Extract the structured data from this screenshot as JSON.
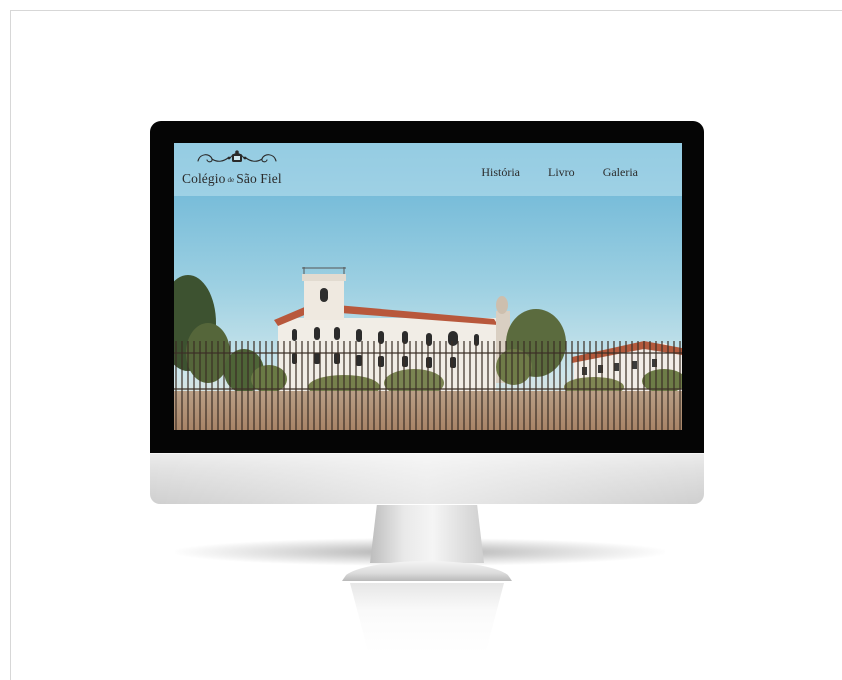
{
  "site": {
    "logo": {
      "word1": "Colégio",
      "word2": "de",
      "word3": "São Fiel"
    },
    "nav": [
      {
        "label": "História"
      },
      {
        "label": "Livro"
      },
      {
        "label": "Galeria"
      }
    ]
  },
  "icons": {
    "logo_ornament": "flourish-crest-icon"
  },
  "colors": {
    "bezel": "#050505",
    "sky_top": "#6fb8d7",
    "header_overlay": "#bee2ee",
    "building_wall": "#f1ede6",
    "roof": "#b8583c"
  }
}
